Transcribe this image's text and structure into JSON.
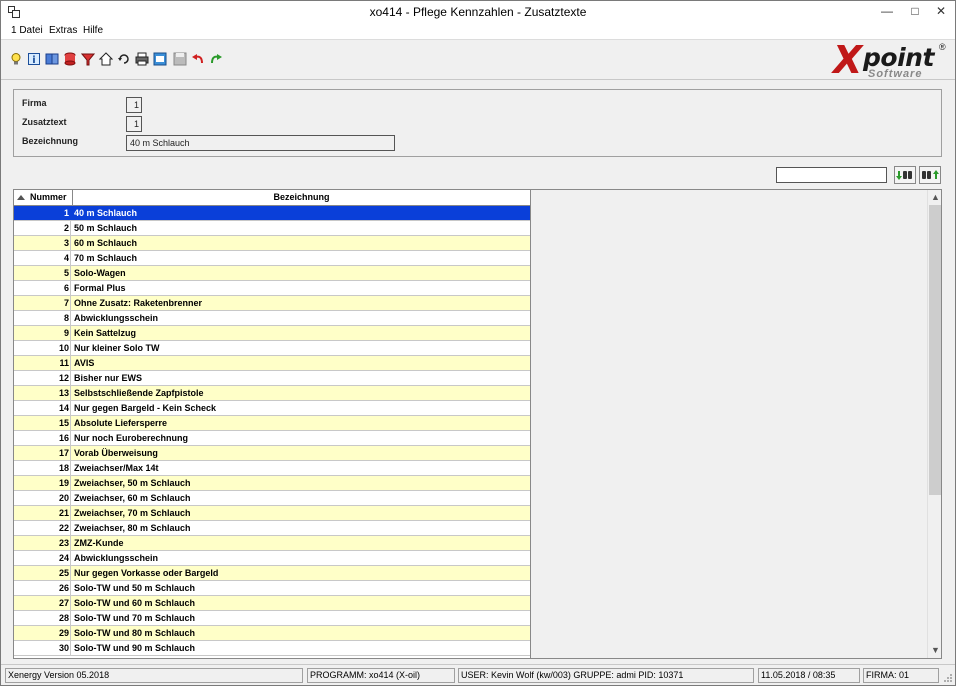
{
  "window": {
    "title": "xo414 - Pflege Kennzahlen - Zusatztexte",
    "minimize": "—",
    "maximize": "□",
    "close": "✕"
  },
  "menu": {
    "items": [
      "1 Datei",
      "Extras",
      "Hilfe"
    ]
  },
  "toolbar": {
    "icons": [
      "lightbulb-icon",
      "info-book-icon",
      "book-icon",
      "database-icon",
      "filter-icon",
      "home-icon",
      "refresh-icon",
      "print-icon",
      "export-icon",
      "save-icon",
      "undo-icon",
      "redo-icon"
    ]
  },
  "logo": {
    "x": "X",
    "point": "point",
    "registered": "®",
    "software": "Software"
  },
  "form": {
    "firma_label": "Firma",
    "firma_value": "1",
    "zusatztext_label": "Zusatztext",
    "zusatztext_value": "1",
    "bezeichnung_label": "Bezeichnung",
    "bezeichnung_value": "40 m Schlauch"
  },
  "search": {
    "value": ""
  },
  "grid": {
    "columns": [
      "Nummer",
      "Bezeichnung"
    ],
    "selected_index": 0,
    "rows": [
      {
        "num": "1",
        "bez": "40 m Schlauch"
      },
      {
        "num": "2",
        "bez": "50 m Schlauch"
      },
      {
        "num": "3",
        "bez": "60 m Schlauch"
      },
      {
        "num": "4",
        "bez": "70 m Schlauch"
      },
      {
        "num": "5",
        "bez": "Solo-Wagen"
      },
      {
        "num": "6",
        "bez": "Formal Plus"
      },
      {
        "num": "7",
        "bez": "Ohne Zusatz: Raketenbrenner"
      },
      {
        "num": "8",
        "bez": "Abwicklungsschein"
      },
      {
        "num": "9",
        "bez": "Kein Sattelzug"
      },
      {
        "num": "10",
        "bez": "Nur kleiner Solo TW"
      },
      {
        "num": "11",
        "bez": "AVIS"
      },
      {
        "num": "12",
        "bez": "Bisher nur EWS"
      },
      {
        "num": "13",
        "bez": "Selbstschließende Zapfpistole"
      },
      {
        "num": "14",
        "bez": "Nur gegen Bargeld - Kein Scheck"
      },
      {
        "num": "15",
        "bez": "Absolute Liefersperre"
      },
      {
        "num": "16",
        "bez": "Nur noch Euroberechnung"
      },
      {
        "num": "17",
        "bez": "Vorab Überweisung"
      },
      {
        "num": "18",
        "bez": "Zweiachser/Max 14t"
      },
      {
        "num": "19",
        "bez": "Zweiachser, 50 m Schlauch"
      },
      {
        "num": "20",
        "bez": "Zweiachser, 60 m Schlauch"
      },
      {
        "num": "21",
        "bez": "Zweiachser, 70 m Schlauch"
      },
      {
        "num": "22",
        "bez": "Zweiachser, 80 m Schlauch"
      },
      {
        "num": "23",
        "bez": "ZMZ-Kunde"
      },
      {
        "num": "24",
        "bez": "Abwicklungsschein"
      },
      {
        "num": "25",
        "bez": "Nur gegen Vorkasse oder Bargeld"
      },
      {
        "num": "26",
        "bez": "Solo-TW und 50 m Schlauch"
      },
      {
        "num": "27",
        "bez": "Solo-TW und 60 m Schlauch"
      },
      {
        "num": "28",
        "bez": "Solo-TW und 70 m Schlauch"
      },
      {
        "num": "29",
        "bez": "Solo-TW und 80 m Schlauch"
      },
      {
        "num": "30",
        "bez": "Solo-TW und 90 m Schlauch"
      }
    ]
  },
  "status": {
    "version": "Xenergy Version 05.2018",
    "programm": "PROGRAMM: xo414 (X-oil)",
    "user": "USER: Kevin Wolf (kw/003)  GRUPPE: admi  PID: 10371",
    "datetime": "11.05.2018 / 08:35",
    "firma": "FIRMA: 01"
  },
  "colors": {
    "row_odd": "#ffffc8",
    "row_even": "#ffffff",
    "row_selected": "#0a3fd9",
    "logo_red": "#c01818"
  }
}
